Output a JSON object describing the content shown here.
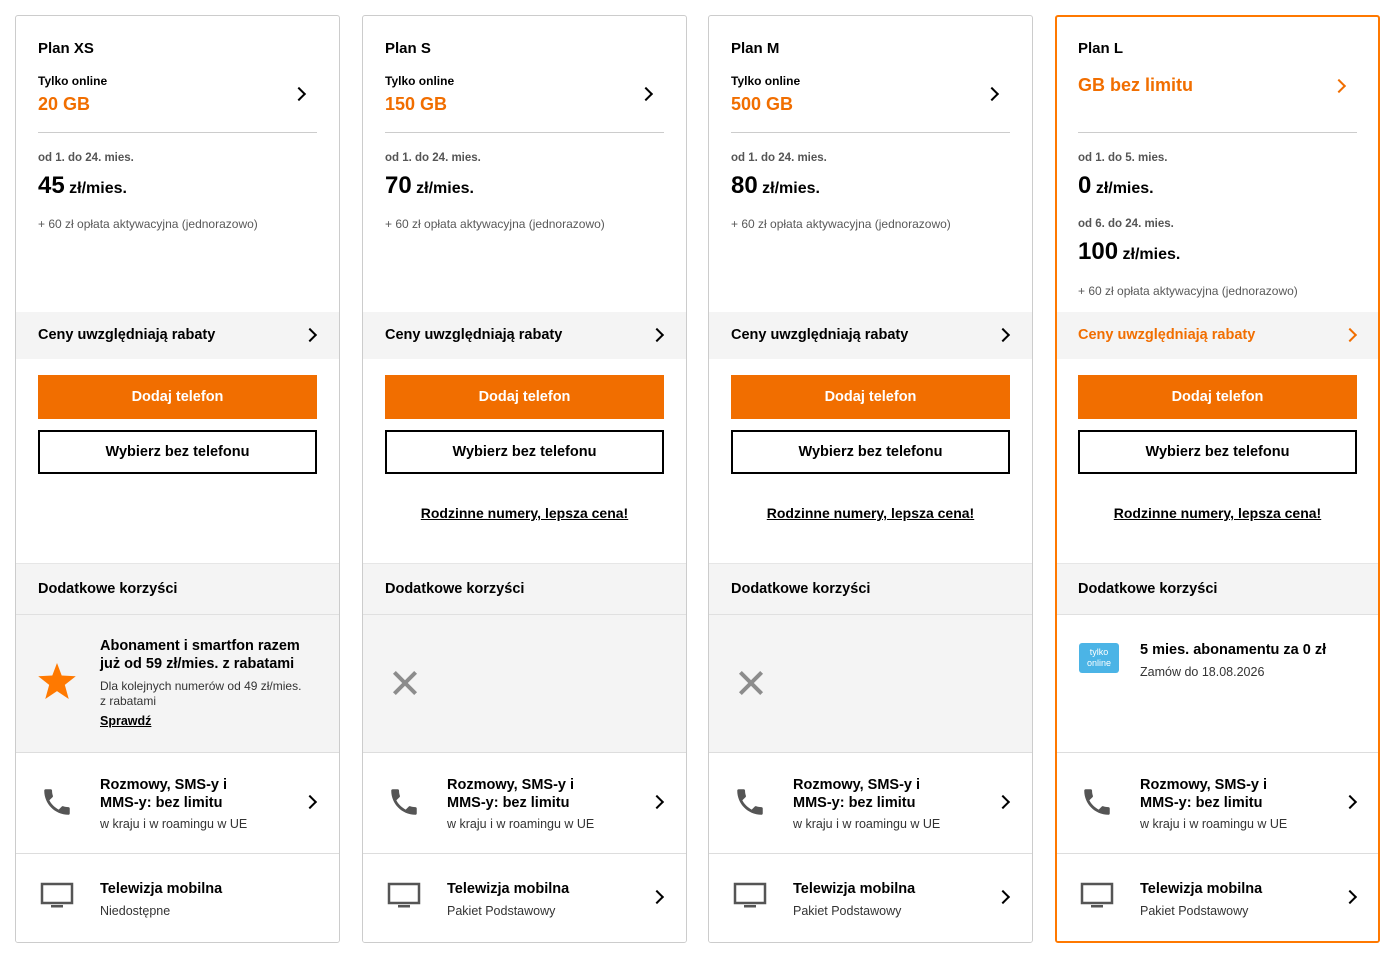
{
  "plans": [
    {
      "name": "Plan XS",
      "badge": "Tylko online",
      "data": "20 GB",
      "periods": [
        {
          "label": "od 1. do 24. mies.",
          "price": "45",
          "unit": "zł/mies."
        }
      ],
      "fee": "+ 60 zł opłata aktywacyjna (jednorazowo)",
      "discounts_label": "Ceny uwzględniają rabaty",
      "add_phone": "Dodaj telefon",
      "without_phone": "Wybierz bez telefonu",
      "family_link": "",
      "benefits_header": "Dodatkowe korzyści",
      "benefit": {
        "icon": "star-icon",
        "title": "Abonament i smartfon razem już od 59 zł/mies. z rabatami",
        "title_line1": "Abonament i smartfon razem",
        "title_line2": "już od 59 zł/mies. z rabatami",
        "desc_line1": "Dla kolejnych numerów od 49 zł/mies.",
        "desc_line2": "z rabatami",
        "link": "Sprawdź"
      },
      "calls": {
        "title_line1": "Rozmowy, SMS-y i",
        "title_line2": "MMS-y: bez limitu",
        "sub": "w kraju i w roamingu w UE"
      },
      "tv": {
        "title": "Telewizja mobilna",
        "sub": "Niedostępne",
        "has_arrow": false
      }
    },
    {
      "name": "Plan S",
      "badge": "Tylko online",
      "data": "150 GB",
      "periods": [
        {
          "label": "od 1. do 24. mies.",
          "price": "70",
          "unit": "zł/mies."
        }
      ],
      "fee": "+ 60 zł opłata aktywacyjna (jednorazowo)",
      "discounts_label": "Ceny uwzględniają rabaty",
      "add_phone": "Dodaj telefon",
      "without_phone": "Wybierz bez telefonu",
      "family_link": "Rodzinne numery, lepsza cena!",
      "benefits_header": "Dodatkowe korzyści",
      "benefit": {
        "icon": "x-icon"
      },
      "calls": {
        "title_line1": "Rozmowy, SMS-y i",
        "title_line2": "MMS-y: bez limitu",
        "sub": "w kraju i w roamingu w UE"
      },
      "tv": {
        "title": "Telewizja mobilna",
        "sub": "Pakiet Podstawowy",
        "has_arrow": true
      }
    },
    {
      "name": "Plan M",
      "badge": "Tylko online",
      "data": "500 GB",
      "periods": [
        {
          "label": "od 1. do 24. mies.",
          "price": "80",
          "unit": "zł/mies."
        }
      ],
      "fee": "+ 60 zł opłata aktywacyjna (jednorazowo)",
      "discounts_label": "Ceny uwzględniają rabaty",
      "add_phone": "Dodaj telefon",
      "without_phone": "Wybierz bez telefonu",
      "family_link": "Rodzinne numery, lepsza cena!",
      "benefits_header": "Dodatkowe korzyści",
      "benefit": {
        "icon": "x-icon"
      },
      "calls": {
        "title_line1": "Rozmowy, SMS-y i",
        "title_line2": "MMS-y: bez limitu",
        "sub": "w kraju i w roamingu w UE"
      },
      "tv": {
        "title": "Telewizja mobilna",
        "sub": "Pakiet Podstawowy",
        "has_arrow": true
      }
    },
    {
      "name": "Plan L",
      "badge": "",
      "data": "GB bez limitu",
      "periods": [
        {
          "label": "od 1. do 5. mies.",
          "price": "0",
          "unit": "zł/mies."
        },
        {
          "label": "od 6. do 24. mies.",
          "price": "100",
          "unit": "zł/mies."
        }
      ],
      "fee": "+ 60 zł opłata aktywacyjna (jednorazowo)",
      "discounts_label": "Ceny uwzględniają rabaty",
      "add_phone": "Dodaj telefon",
      "without_phone": "Wybierz bez telefonu",
      "family_link": "Rodzinne numery, lepsza cena!",
      "benefits_header": "Dodatkowe korzyści",
      "benefit": {
        "icon": "tylko-online-badge",
        "badge_line1": "tylko",
        "badge_line2": "online",
        "title": "5 mies. abonamentu za 0 zł",
        "desc": "Zamów do 18.08.2026"
      },
      "calls": {
        "title_line1": "Rozmowy, SMS-y i",
        "title_line2": "MMS-y: bez limitu",
        "sub": "w kraju i w roamingu w UE"
      },
      "tv": {
        "title": "Telewizja mobilna",
        "sub": "Pakiet Podstawowy",
        "has_arrow": true
      }
    }
  ],
  "colors": {
    "accent": "#f16e00",
    "badge_blue": "#4bb4e6",
    "grey_bg": "#f4f4f4"
  }
}
